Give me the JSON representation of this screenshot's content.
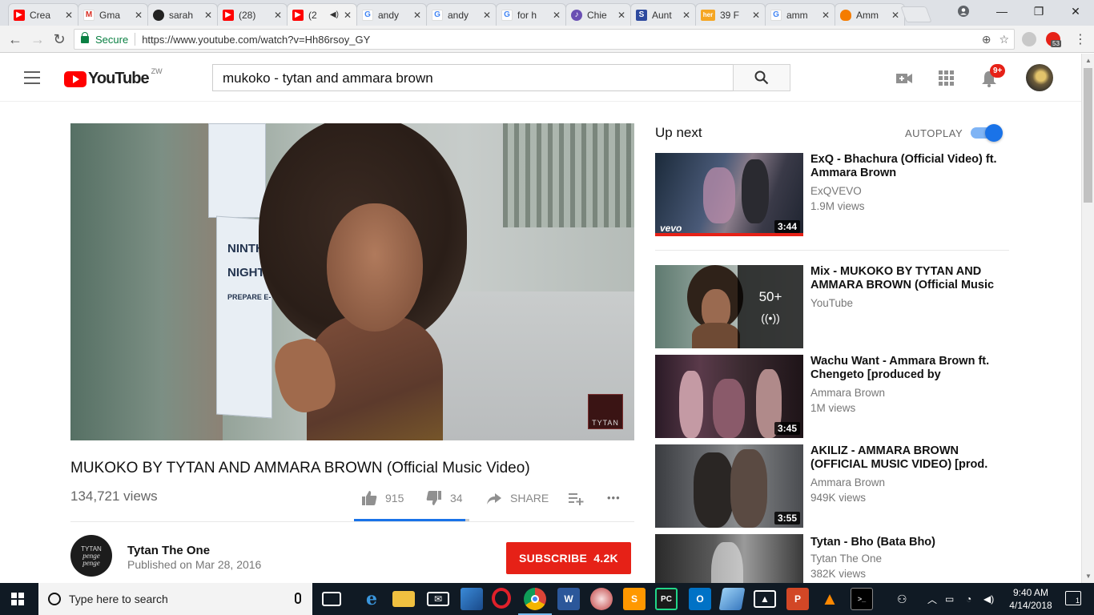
{
  "browser": {
    "tabs": [
      {
        "label": "Crea",
        "favicon": "youtube-icon",
        "color": "#ff0000"
      },
      {
        "label": "Gma",
        "favicon": "gmail-icon",
        "color": "#d93025"
      },
      {
        "label": "sarah",
        "favicon": "github-icon",
        "color": "#222222"
      },
      {
        "label": "(28)",
        "favicon": "youtube-icon",
        "color": "#ff0000"
      },
      {
        "label": "(2",
        "favicon": "youtube-icon",
        "color": "#ff0000",
        "audio": "speaker-icon"
      },
      {
        "label": "andy",
        "favicon": "google-icon",
        "color": "#4285f4"
      },
      {
        "label": "andy",
        "favicon": "google-icon",
        "color": "#4285f4"
      },
      {
        "label": "for h",
        "favicon": "google-icon",
        "color": "#4285f4"
      },
      {
        "label": "Chie",
        "favicon": "guitar-icon",
        "color": "#6a4fb3"
      },
      {
        "label": "Aunt",
        "favicon": "s-icon",
        "color": "#2e4a9e"
      },
      {
        "label": "39 F",
        "favicon": "her-icon",
        "color": "#f5a623"
      },
      {
        "label": "amm",
        "favicon": "google-icon",
        "color": "#4285f4"
      },
      {
        "label": "Amm",
        "favicon": "flame-icon",
        "color": "#f57c00"
      }
    ],
    "close_glyph": "✕",
    "secure_label": "Secure",
    "url": "https://www.youtube.com/watch?v=Hh86rsoy_GY",
    "extension_badge": "53"
  },
  "youtube": {
    "logo_text": "YouTube",
    "country_code": "ZW",
    "search_query": "mukoko - tytan and ammara brown",
    "notification_count": "9+"
  },
  "video": {
    "title": "MUKOKO BY TYTAN AND AMMARA BROWN (Official Music Video)",
    "views": "134,721 views",
    "likes": "915",
    "dislikes": "34",
    "like_fraction": 0.964,
    "share_label": "SHARE",
    "more_glyph": "•••",
    "poster_lines": [
      "NINTH",
      "NIGHT",
      "PREPARE E-"
    ],
    "watermark": "TYTAN",
    "channel_name": "Tytan The One",
    "channel_avatar_lines": [
      "TYTAN",
      "penge",
      "penge"
    ],
    "published": "Published on Mar 28, 2016",
    "subscribe_label": "SUBSCRIBE",
    "subscriber_count": "4.2K"
  },
  "up_next": {
    "heading": "Up next",
    "autoplay_label": "AUTOPLAY",
    "autoplay_on": true,
    "items": [
      {
        "title": "ExQ - Bhachura (Official Video) ft. Ammara Brown",
        "channel": "ExQVEVO",
        "views": "1.9M views",
        "duration": "3:44",
        "badge": "vevo",
        "watched_fraction": 1.0
      },
      {
        "title": "Mix - MUKOKO BY TYTAN AND AMMARA BROWN (Official Music",
        "channel": "YouTube",
        "views": "",
        "mix_count": "50+"
      },
      {
        "title": "Wachu Want - Ammara Brown ft. Chengeto [produced by",
        "channel": "Ammara Brown",
        "views": "1M views",
        "duration": "3:45"
      },
      {
        "title": "AKILIZ - AMMARA BROWN (OFFICIAL MUSIC VIDEO) [prod.",
        "channel": "Ammara Brown",
        "views": "949K views",
        "duration": "3:55"
      },
      {
        "title": "Tytan - Bho (Bata Bho)",
        "channel": "Tytan The One",
        "views": "382K views",
        "duration": ""
      }
    ]
  },
  "taskbar": {
    "search_placeholder": "Type here to search",
    "time": "9:40 AM",
    "date": "4/14/2018",
    "notification_count": "1"
  }
}
